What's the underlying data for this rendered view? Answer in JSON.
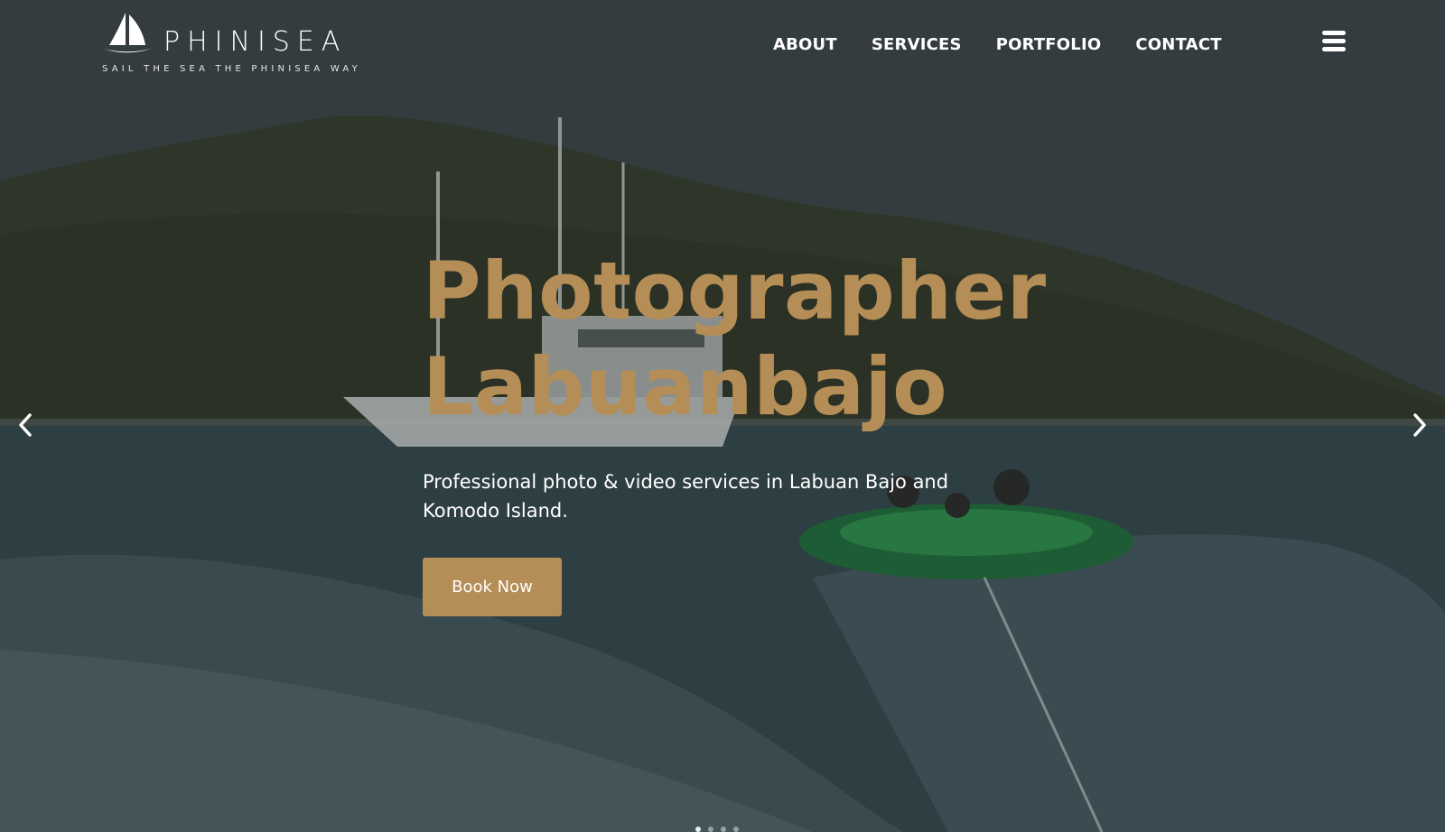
{
  "brand": {
    "name": "PHINISEA",
    "tagline": "SAIL THE SEA THE PHINISEA WAY"
  },
  "nav": {
    "items": [
      {
        "label": "ABOUT"
      },
      {
        "label": "SERVICES"
      },
      {
        "label": "PORTFOLIO"
      },
      {
        "label": "CONTACT"
      }
    ],
    "menu_icon": "hamburger-menu-icon"
  },
  "hero": {
    "headline_line1": "Photographer",
    "headline_line2": "Labuanbajo",
    "subtitle": "Professional photo & video services in Labuan Bajo and Komodo Island.",
    "cta_label": "Book Now",
    "prev_icon": "chevron-left-icon",
    "next_icon": "chevron-right-icon",
    "background_description_icon": "boat-island-photo"
  },
  "colors": {
    "accent": "#b58e57",
    "text": "#ffffff",
    "overlay": "#2c3438"
  }
}
